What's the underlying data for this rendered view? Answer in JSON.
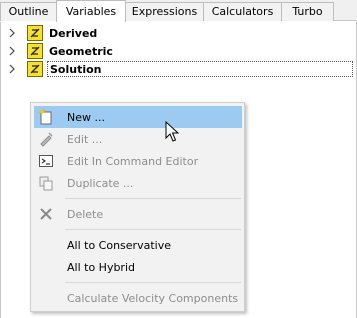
{
  "tabs": [
    {
      "label": "Outline",
      "active": false
    },
    {
      "label": "Variables",
      "active": true
    },
    {
      "label": "Expressions",
      "active": false
    },
    {
      "label": "Calculators",
      "active": false
    },
    {
      "label": "Turbo",
      "active": false
    }
  ],
  "tree": {
    "items": [
      {
        "label": "Derived",
        "icon": "variable-group-icon",
        "expanded": false
      },
      {
        "label": "Geometric",
        "icon": "variable-group-icon",
        "expanded": false
      },
      {
        "label": "Solution",
        "icon": "variable-group-icon",
        "expanded": false,
        "selected": true
      }
    ]
  },
  "context_menu": {
    "items": [
      {
        "label": "New ...",
        "icon": "new-icon",
        "enabled": true,
        "highlighted": true
      },
      {
        "label": "Edit ...",
        "icon": "edit-icon",
        "enabled": false
      },
      {
        "label": "Edit In Command Editor",
        "icon": "command-editor-icon",
        "enabled": false
      },
      {
        "label": "Duplicate ...",
        "icon": "duplicate-icon",
        "enabled": false
      },
      {
        "label": "Delete",
        "icon": "delete-icon",
        "enabled": false
      },
      {
        "label": "All to Conservative",
        "icon": "",
        "enabled": true
      },
      {
        "label": "All to Hybrid",
        "icon": "",
        "enabled": true
      },
      {
        "label": "Calculate Velocity Components",
        "icon": "",
        "enabled": false
      }
    ]
  },
  "colors": {
    "highlight": "#9ccaf1",
    "disabled_text": "#8d8d8d",
    "group_icon": "#f5e22e"
  }
}
